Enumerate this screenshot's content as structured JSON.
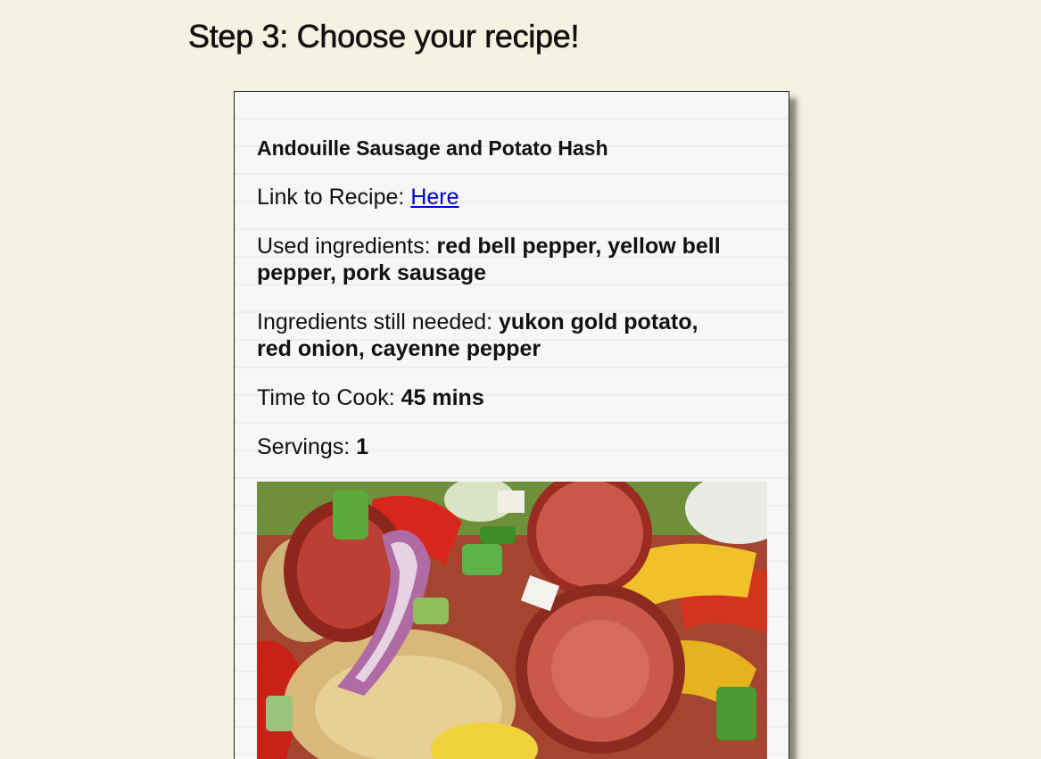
{
  "page": {
    "heading": "Step 3: Choose your recipe!"
  },
  "recipe": {
    "title": "Andouille Sausage and Potato Hash",
    "link_label": "Link to Recipe: ",
    "link_text": "Here",
    "used_label": "Used ingredients: ",
    "used_value": "red bell pepper, yellow bell pepper, pork sausage",
    "needed_label": "Ingredients still needed: ",
    "needed_value": "yukon gold potato, red onion, cayenne pepper",
    "time_label": "Time to Cook: ",
    "time_value": "45 mins",
    "servings_label": "Servings: ",
    "servings_value": "1"
  },
  "colors": {
    "background": "#f6f2e1",
    "card": "#f7f7f6",
    "link": "#0000cc"
  }
}
